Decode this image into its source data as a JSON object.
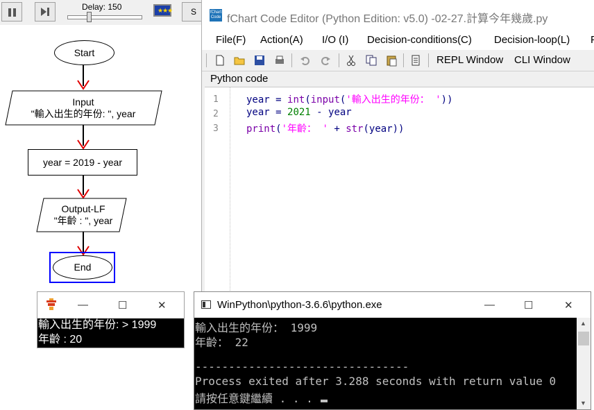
{
  "flow_app": {
    "delay_label": "Delay: 150",
    "s_button_label": "S",
    "nodes": {
      "start": "Start",
      "input_title": "Input",
      "input_args": "\"輸入出生的年份: \", year",
      "assign": "year = 2019 - year",
      "output_title": "Output-LF",
      "output_args": "\"年齡 : \", year",
      "end": "End"
    }
  },
  "editor": {
    "title": "fChart Code Editor (Python Edition: v5.0) -02-27.計算今年幾歲.py",
    "logo_text": "fChart Code",
    "menu": [
      "File(F)",
      "Action(A)",
      "I/O (I)",
      "Decision-conditions(C)",
      "Decision-loop(L)",
      "P"
    ],
    "tool_text": [
      "REPL Window",
      "CLI Window"
    ],
    "code_label": "Python code",
    "line_numbers": [
      "1",
      "2",
      "3"
    ],
    "code": {
      "l1_var": "year",
      "l1_eq": " = ",
      "l1_int": "int",
      "l1_p1": "(",
      "l1_input": "input",
      "l1_p2": "(",
      "l1_str": "'輸入出生的年份： '",
      "l1_p3": "))",
      "l2_var": "year",
      "l2_eq": " = ",
      "l2_num": "2021",
      "l2_rest": " - year",
      "l3_print": "print",
      "l3_p1": "(",
      "l3_str": "'年齡： '",
      "l3_plus": " + ",
      "l3_str_fn": "str",
      "l3_rest": "(year))"
    }
  },
  "small_console": {
    "line1": "輸入出生的年份: > 1999",
    "line2": "年齡 :  20"
  },
  "python_console": {
    "title": "WinPython\\python-3.6.6\\python.exe",
    "lines": [
      "輸入出生的年份： 1999",
      "年齡： 22",
      "",
      "--------------------------------",
      "Process exited after 3.288 seconds with return value 0",
      "請按任意鍵繼續 . . . "
    ]
  },
  "window_controls": {
    "minimize": "—",
    "maximize": "☐",
    "close": "✕"
  },
  "colors": {
    "arrow_red": "#e00000",
    "end_highlight": "#0000ff",
    "string_magenta": "#ff00ff"
  },
  "icons": [
    "pause-icon",
    "step-icon",
    "eu-flag-icon",
    "new-file-icon",
    "open-folder-icon",
    "save-icon",
    "print-icon",
    "undo-icon",
    "redo-icon",
    "cut-icon",
    "copy-icon",
    "paste-icon",
    "page-icon"
  ]
}
